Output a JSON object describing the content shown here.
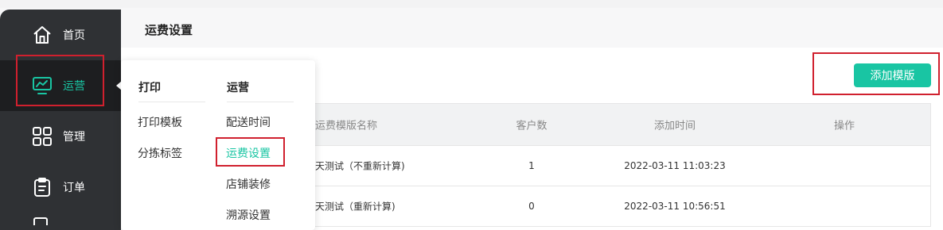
{
  "sidebar": {
    "items": [
      {
        "label": "首页",
        "icon": "home-icon"
      },
      {
        "label": "运营",
        "icon": "monitor-chart-icon"
      },
      {
        "label": "管理",
        "icon": "grid-icon"
      },
      {
        "label": "订单",
        "icon": "clipboard-icon"
      }
    ]
  },
  "header": {
    "title": "运费设置"
  },
  "toolbar": {
    "add_label": "添加模版"
  },
  "table": {
    "columns": [
      "运费模版名称",
      "客户数",
      "添加时间",
      "操作"
    ],
    "rows": [
      {
        "name": "天测试（不重新计算)",
        "customers": "1",
        "time": "2022-03-11 11:03:23"
      },
      {
        "name": "天测试（重新计算)",
        "customers": "0",
        "time": "2022-03-11 10:56:51"
      }
    ]
  },
  "dropdown": {
    "groups": [
      {
        "title": "打印",
        "items": [
          "打印模板",
          "分拣标签"
        ]
      },
      {
        "title": "运营",
        "items": [
          "配送时间",
          "运费设置",
          "店铺装修",
          "溯源设置"
        ]
      }
    ]
  },
  "colors": {
    "accent": "#19c5a3",
    "highlight": "#d0202e",
    "sidebar": "#2f3134"
  }
}
